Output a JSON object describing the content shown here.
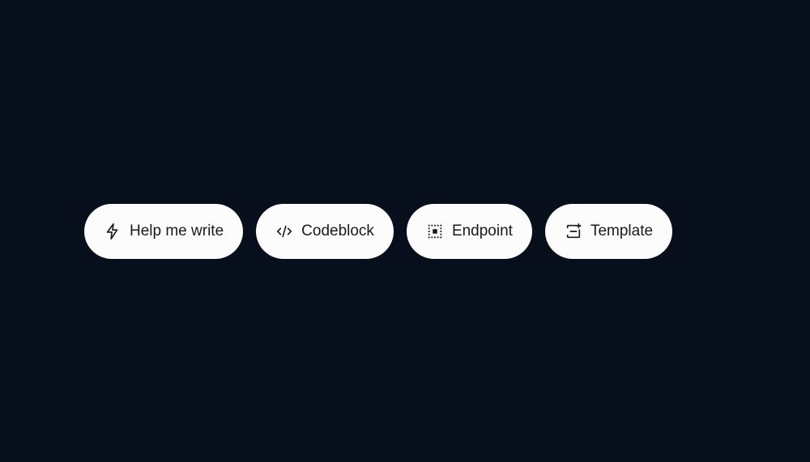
{
  "buttons": [
    {
      "label": "Help me write",
      "icon": "lightning-icon"
    },
    {
      "label": "Codeblock",
      "icon": "code-icon"
    },
    {
      "label": "Endpoint",
      "icon": "square-icon"
    },
    {
      "label": "Template",
      "icon": "template-icon"
    }
  ]
}
